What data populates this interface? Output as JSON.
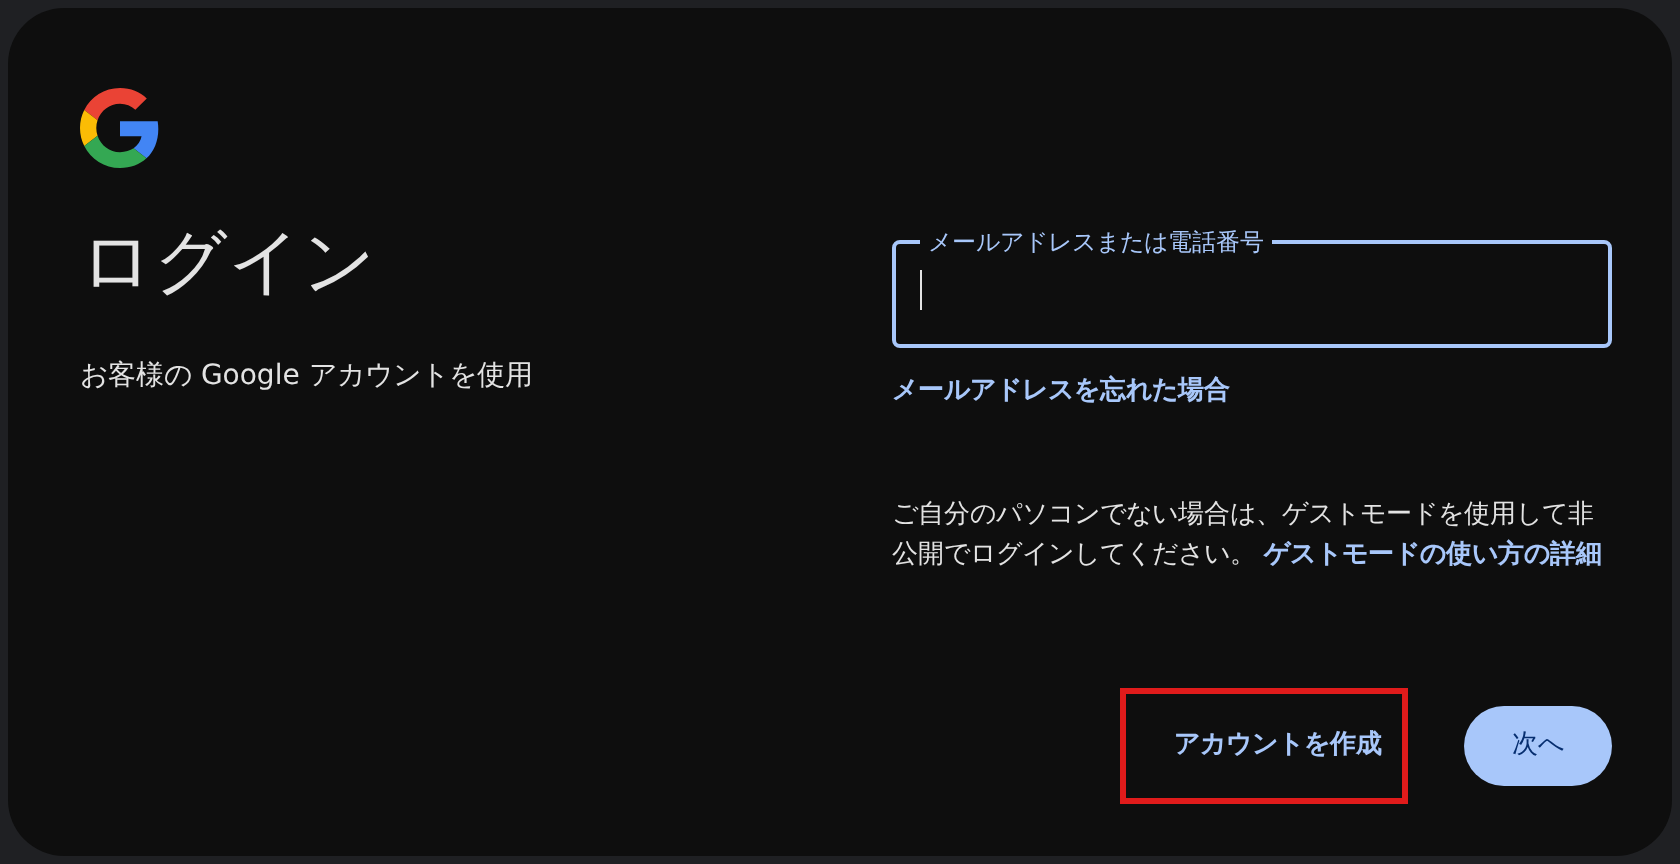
{
  "title": "ログイン",
  "subtitle": "お客様の Google アカウントを使用",
  "email_field": {
    "label": "メールアドレスまたは電話番号",
    "focused": true
  },
  "forgot_email_link": "メールアドレスを忘れた場合",
  "guest_note": {
    "text": "ご自分のパソコンでない場合は、ゲストモードを使用して非公開でログインしてください。",
    "link": "ゲストモードの使い方の詳細"
  },
  "create_account_button": {
    "label": "アカウントを作成",
    "highlighted": true
  },
  "next_button": {
    "label": "次へ"
  }
}
